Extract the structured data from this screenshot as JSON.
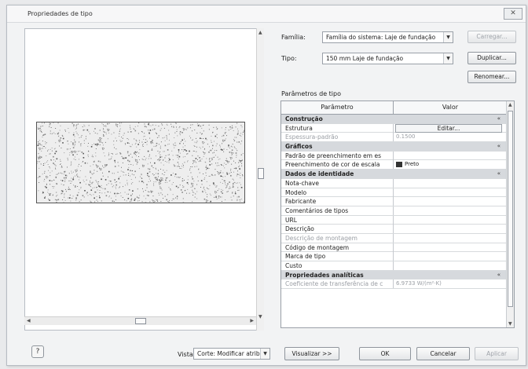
{
  "window": {
    "title": "Propriedades de tipo",
    "close_label": "✕"
  },
  "header": {
    "family_label": "Família:",
    "family_value": "Família do sistema: Laje de fundação",
    "type_label": "Tipo:",
    "type_value": "150 mm Laje de fundação",
    "load_button": "Carregar...",
    "duplicate_button": "Duplicar...",
    "rename_button": "Renomear..."
  },
  "type_params": {
    "section_label": "Parâmetros de tipo",
    "col_param": "Parâmetro",
    "col_value": "Valor"
  },
  "rows": [
    {
      "kind": "group",
      "param": "Construção",
      "value": ""
    },
    {
      "kind": "button",
      "param": "Estrutura",
      "value": "Editar..."
    },
    {
      "kind": "dim",
      "param": "Espessura-padrão",
      "value": "0.1500"
    },
    {
      "kind": "group",
      "param": "Gráficos",
      "value": ""
    },
    {
      "kind": "text",
      "param": "Padrão de preenchimento em es",
      "value": ""
    },
    {
      "kind": "swatch",
      "param": "Preenchimento de cor de escala",
      "value": "Preto"
    },
    {
      "kind": "group",
      "param": "Dados de identidade",
      "value": ""
    },
    {
      "kind": "text",
      "param": "Nota-chave",
      "value": ""
    },
    {
      "kind": "text",
      "param": "Modelo",
      "value": ""
    },
    {
      "kind": "text",
      "param": "Fabricante",
      "value": ""
    },
    {
      "kind": "text",
      "param": "Comentários de tipos",
      "value": ""
    },
    {
      "kind": "text",
      "param": "URL",
      "value": ""
    },
    {
      "kind": "text",
      "param": "Descrição",
      "value": ""
    },
    {
      "kind": "dim",
      "param": "Descrição de montagem",
      "value": ""
    },
    {
      "kind": "text",
      "param": "Código de montagem",
      "value": ""
    },
    {
      "kind": "text",
      "param": "Marca de tipo",
      "value": ""
    },
    {
      "kind": "text",
      "param": "Custo",
      "value": ""
    },
    {
      "kind": "group",
      "param": "Propriedades analíticas",
      "value": ""
    },
    {
      "kind": "dim",
      "param": "Coeficiente de transferência de c",
      "value": "6.9733 W/(m²·K)"
    }
  ],
  "footer": {
    "view_label": "Vista:",
    "view_value": "Corte: Modificar atrib",
    "preview_button": "Visualizar >>",
    "ok_button": "OK",
    "cancel_button": "Cancelar",
    "apply_button": "Aplicar"
  },
  "colors": {
    "group_row": "#d6d9dd",
    "swatch": "#333333"
  }
}
